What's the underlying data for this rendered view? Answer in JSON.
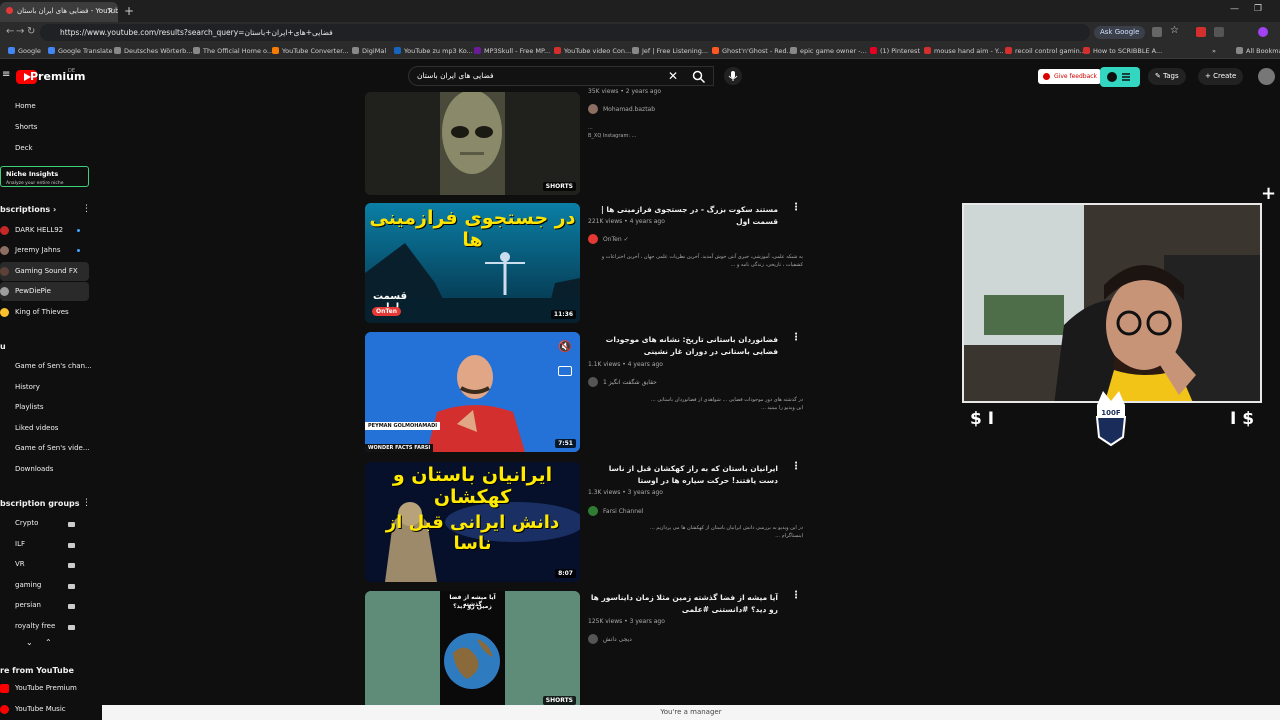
{
  "browser": {
    "tab_title": "فضایی های ایران باستان - YouTube",
    "url": "https://www.youtube.com/results?search_query=فضایی+های+ایران+باستان",
    "ask_google": "Ask Google",
    "all_bookmarks": "All Bookmarks",
    "bookmarks": [
      "Google",
      "Google Translate",
      "Deutsches Wörterb...",
      "The Official Home o...",
      "YouTube Converter...",
      "DigiMal",
      "YouTube zu mp3 Ko...",
      "MP3Skull - Free MP...",
      "YouTube video Con...",
      "Jef | Free Listening...",
      "Ghost'n'Ghost - Red...",
      "epic game owner -...",
      "(1) Pinterest",
      "mouse hand aim - Y...",
      "recoil control gamin...",
      "How to SCRIBBLE A..."
    ]
  },
  "youtube": {
    "brand": "Premium",
    "region": "DE",
    "search_value": "فضایی های ایران باستان",
    "give_feedback": "Give feedback",
    "tags_label": "Tags",
    "create_label": "Create"
  },
  "sidebar": {
    "top": [
      "Home",
      "Shorts",
      "Deck"
    ],
    "niche_title": "Niche Insights",
    "niche_sub": "Analyze your entire niche",
    "subs_title": "bscriptions",
    "subs": [
      "DARK HELL92",
      "Jeremy Jahns",
      "Gaming Sound FX",
      "PewDiePie",
      "King of Thieves"
    ],
    "you_title": "u",
    "you_items": [
      "Game of Sen's chan...",
      "History",
      "Playlists",
      "Liked videos",
      "Game of Sen's vide...",
      "Downloads"
    ],
    "groups_title": "bscription groups",
    "groups": [
      "Crypto",
      "ILF",
      "VR",
      "gaming",
      "persian",
      "royalty free"
    ],
    "more_title": "re from YouTube",
    "more": [
      "YouTube Premium",
      "YouTube Music"
    ]
  },
  "videos": [
    {
      "meta": "35K views • 2 years ago",
      "channel": "Mohamad.baztab",
      "desc": "...",
      "desc2": "B_XQ Instagram: ...",
      "badge": "SHORTS"
    },
    {
      "title": "مستند سکوت بزرگ - در جستجوی فرازمینی ها | قسمت اول",
      "meta": "221K views • 4 years ago",
      "channel": "OnTen",
      "desc": "به شبکه علمی، آموزشی، خبری آنتن خوش آمدید. آخرین نظریات علمی جهان ، آخرین اختراعات و کشفیات ، تاریخی، زندگی نامه و ...",
      "duration": "11:36",
      "thumb_top": "در جستجوی فرازمینی ها",
      "thumb_bottom": "قسمت اول",
      "thumb_logo": "OnTen"
    },
    {
      "title": "فضانوردان باستانی تاریخ: نشانه های موجودات فضایی باستانی در دوران غار نشینی",
      "meta": "1.1K views • 4 years ago",
      "channel": "حقایق شگفت انگیز 1",
      "desc": "در گذشته های دور موجودات فضایی ... شواهدی از فضانوردان باستانی ...",
      "desc2": "این ویدیو را ببینید ...",
      "duration": "7:51",
      "thumb_caption": "PEYMAN GOLMOHAMADI",
      "thumb_caption2": "WONDER FACTS FARSI"
    },
    {
      "title": "ایرانیان باستان که به راز کهکشان قبل از ناسا دست یافتند! حرکت سیاره ها در اوستا",
      "meta": "1.3K views • 3 years ago",
      "channel": "Farsi Channel",
      "desc": "در این ویدیو به بررسی دانش ایرانیان باستان از کهکشان ها می پردازیم ...",
      "desc2": "اینستاگرام ...",
      "duration": "8:07",
      "thumb_top": "ایرانیان باستان و کهکشان",
      "thumb_bottom": "دانش ایرانی قبل از ناسا"
    },
    {
      "title": "آیا میشه از فضا گذشته زمین مثلا زمان دایناسور ها رو دید؟ #دانستنی #علمی",
      "meta": "125K views • 3 years ago",
      "channel": "دیجی دانش",
      "thumb_top": "آیا میشه از فضا گذشته",
      "thumb_top2": "زمین رو دید؟",
      "badge": "SHORTS"
    }
  ],
  "overlay": {
    "dollar_left": "$ I",
    "dollar_right": "I $",
    "plus": "+",
    "crown_text": "100F"
  },
  "footer": {
    "text": "You're a manager"
  },
  "colors": {
    "youtube_red": "#ff0000",
    "accent_green": "#3fd07b",
    "teal": "#33d6c1"
  }
}
